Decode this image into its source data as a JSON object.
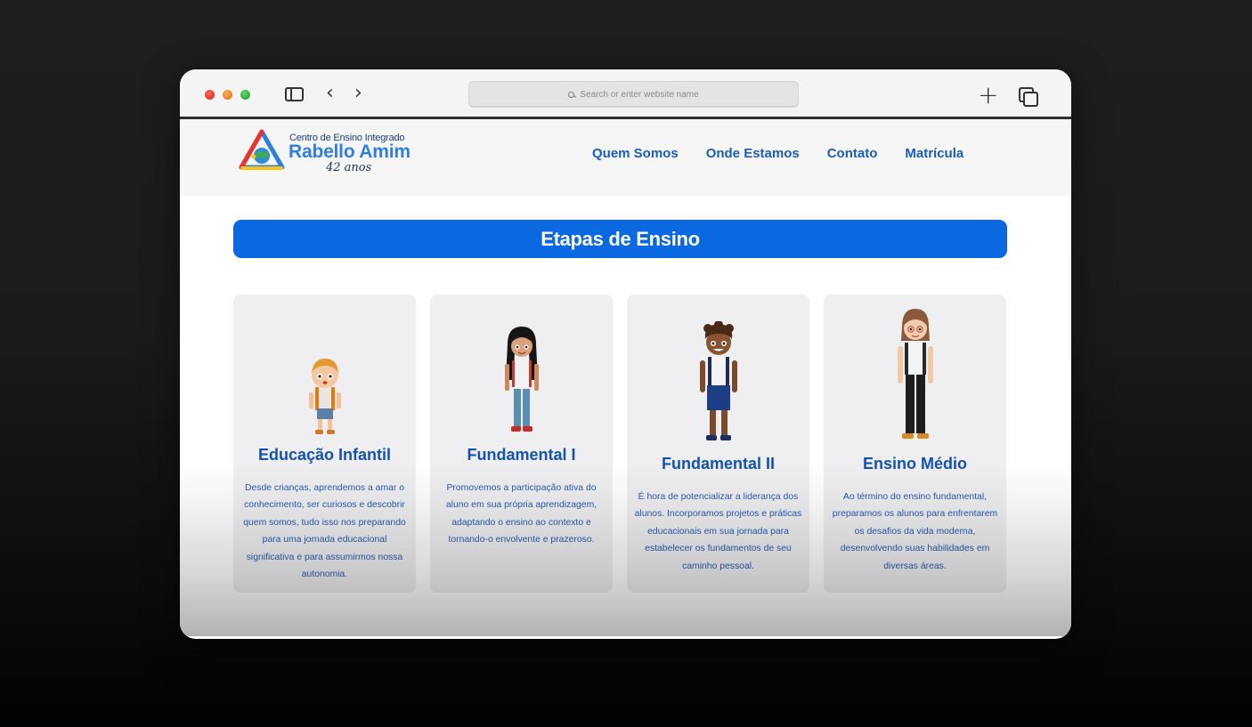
{
  "browser": {
    "address_placeholder": "Search or enter website name",
    "icons": [
      "close-dot",
      "minimize-dot",
      "zoom-dot",
      "sidebar-icon",
      "back-icon",
      "forward-icon",
      "search-icon",
      "new-tab-icon",
      "tabs-overview-icon"
    ]
  },
  "site": {
    "logo": {
      "line1": "Centro de Ensino Integrado",
      "line2": "Rabello Amim",
      "line3": "42 anos"
    },
    "nav": [
      {
        "label": "Quem Somos"
      },
      {
        "label": "Onde Estamos"
      },
      {
        "label": "Contato"
      },
      {
        "label": "Matrícula"
      }
    ],
    "section_title": "Etapas de Ensino",
    "cards": [
      {
        "title": "Educação Infantil",
        "text": "Desde crianças, aprendemos a amar o conhecimento, ser curiosos e descobrir quem somos, tudo isso nos preparando para uma jornada educacional significativa e para assumirmos nossa autonomia.",
        "illustration": "young-child"
      },
      {
        "title": "Fundamental I",
        "text": "Promovemos a participação ativa do aluno em sua própria aprendizagem, adaptando o ensino ao contexto e tornando-o envolvente e prazeroso.",
        "illustration": "girl-student"
      },
      {
        "title": "Fundamental II",
        "text": "É hora de potencializar a liderança dos alunos. Incorporamos projetos e práticas educacionais em sua jornada para estabelecer os fundamentos de seu caminho pessoal.",
        "illustration": "boy-student"
      },
      {
        "title": "Ensino Médio",
        "text": "Ao término do ensino fundamental, preparamos os alunos para enfrentarem os desafios da vida moderna, desenvolvendo suas habilidades em diversas áreas.",
        "illustration": "teen-student"
      }
    ]
  },
  "colors": {
    "primary_blue": "#0a68e0",
    "heading_blue": "#1352b0",
    "nav_blue": "#1a5bbf",
    "card_bg": "#efeff1"
  }
}
